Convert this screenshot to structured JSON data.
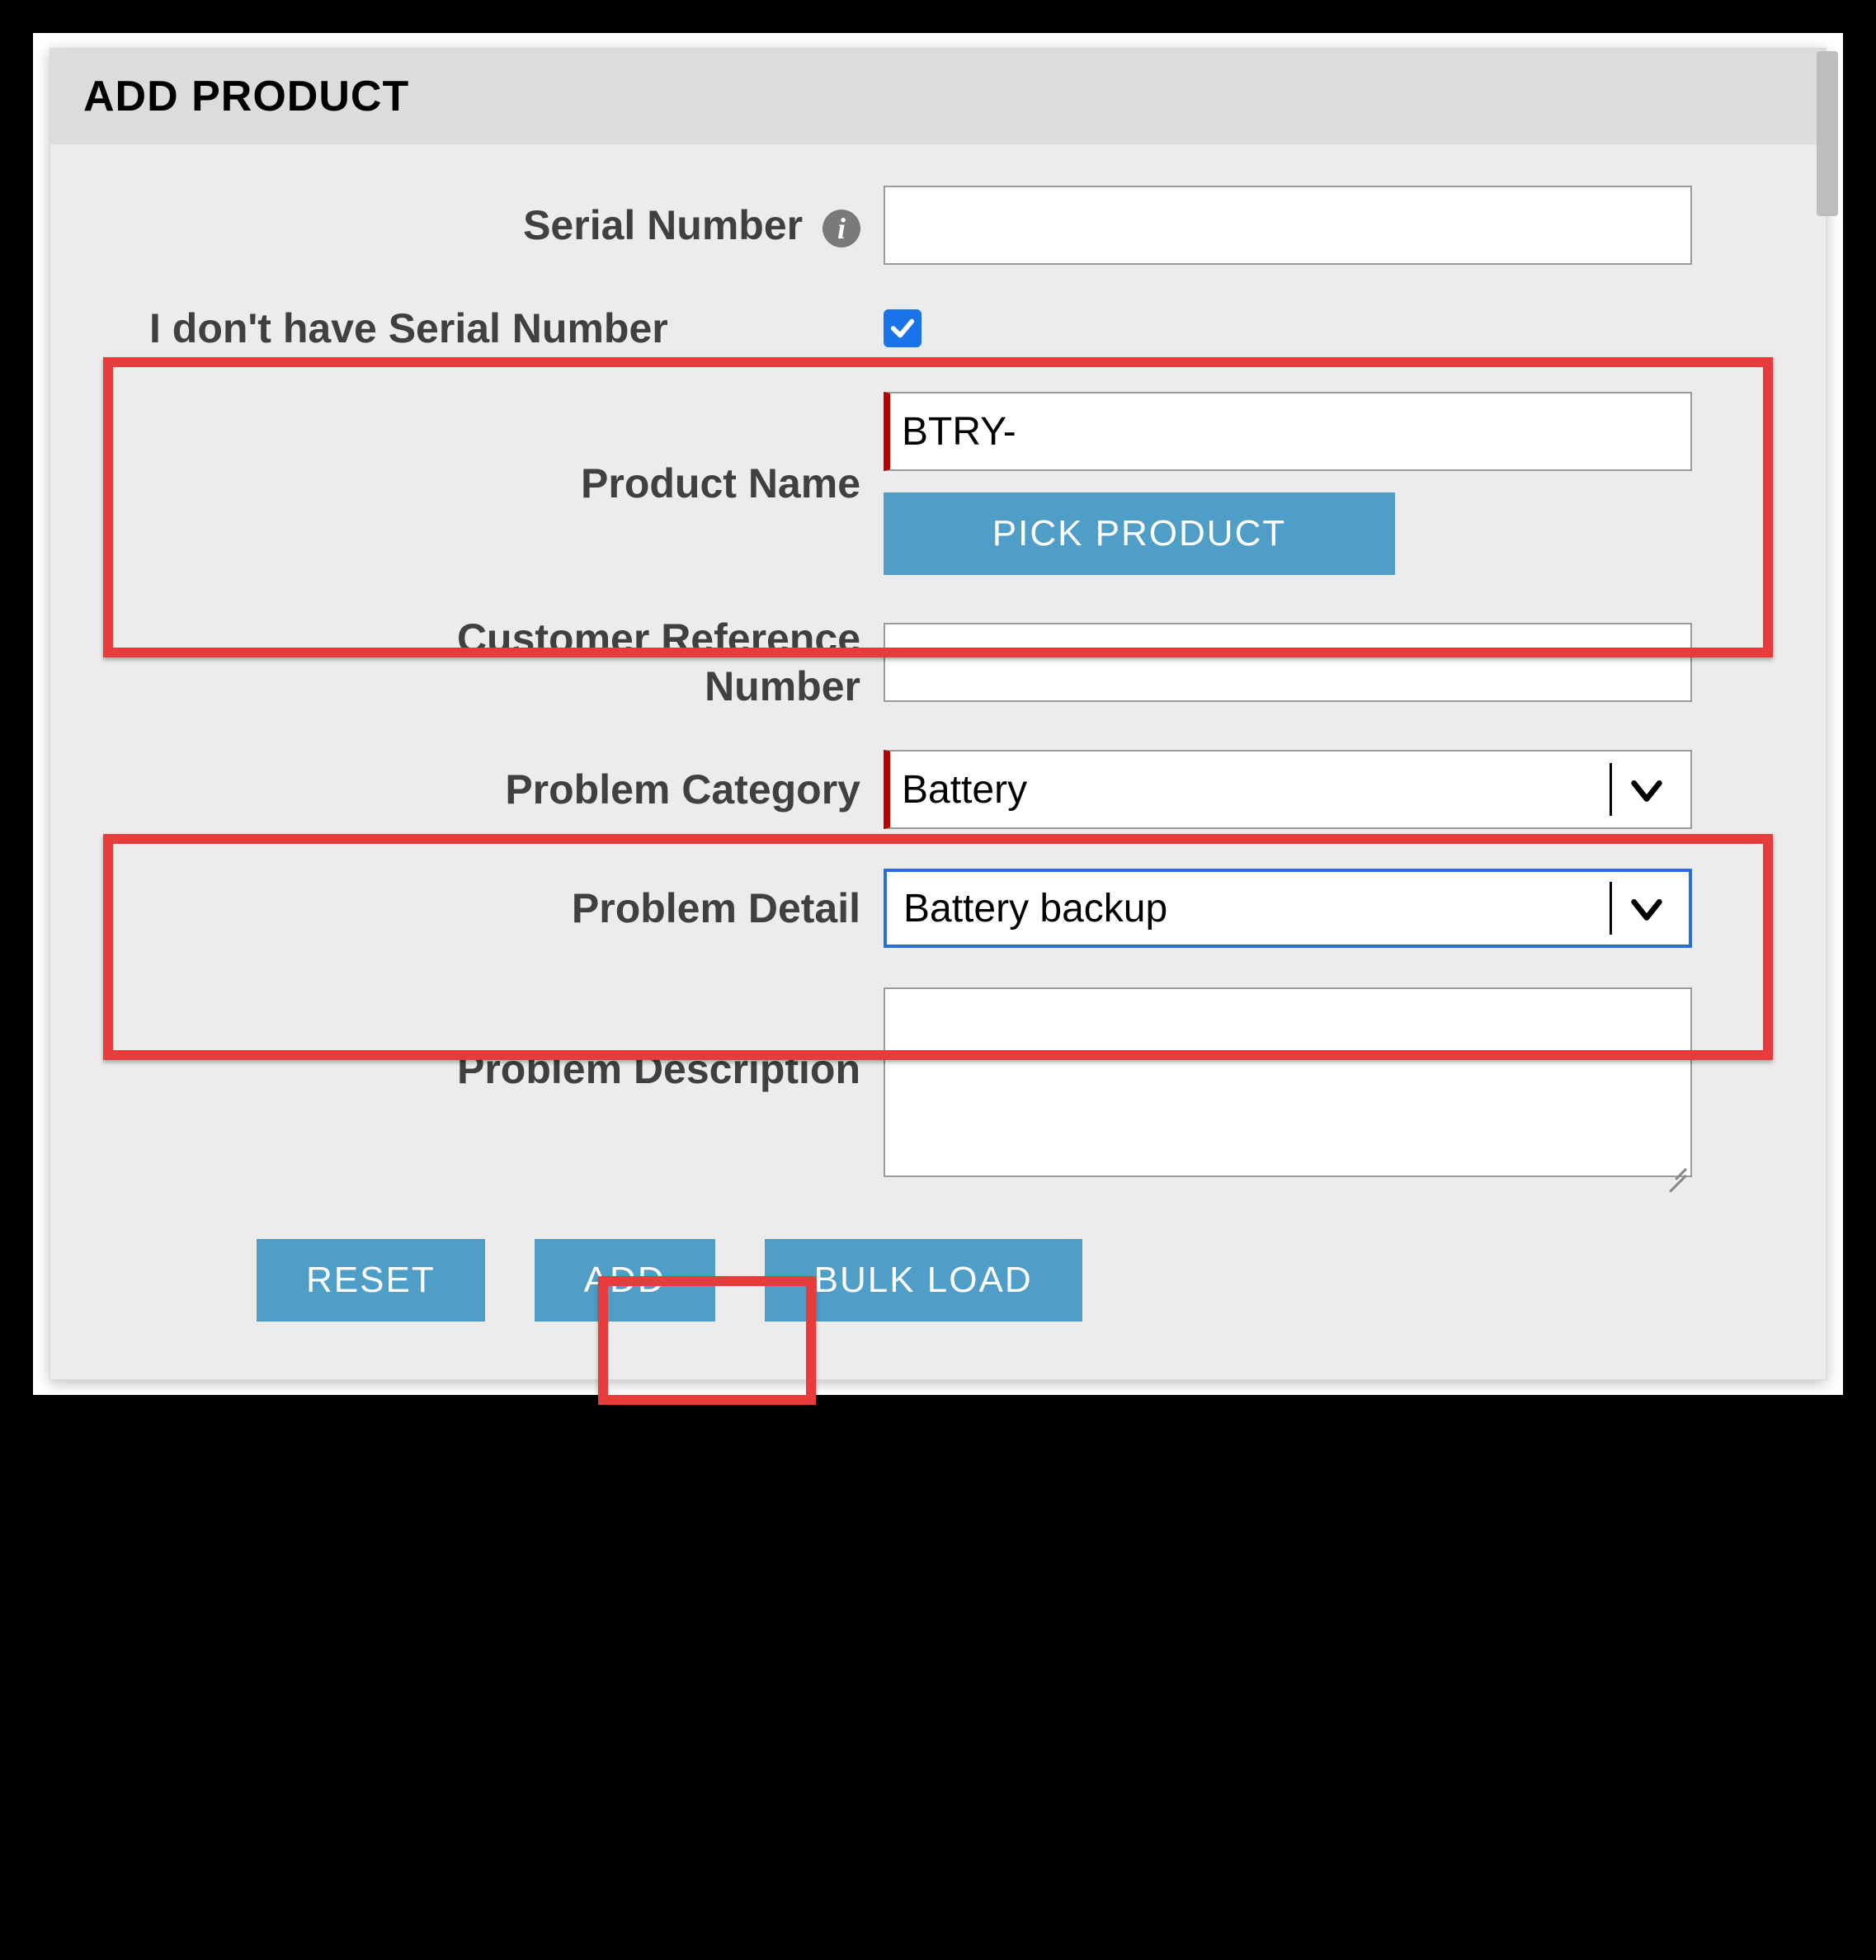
{
  "panel": {
    "title": "ADD PRODUCT"
  },
  "form": {
    "serial_number": {
      "label": "Serial Number",
      "value": ""
    },
    "no_serial": {
      "label": "I don't have Serial Number",
      "checked": true
    },
    "product_name": {
      "label": "Product Name",
      "value": "BTRY-"
    },
    "pick_product_label": "PICK PRODUCT",
    "customer_ref": {
      "label": "Customer Reference Number",
      "value": ""
    },
    "problem_category": {
      "label": "Problem Category",
      "value": "Battery"
    },
    "problem_detail": {
      "label": "Problem Detail",
      "value": "Battery backup"
    },
    "problem_description": {
      "label": "Problem Description",
      "value": ""
    }
  },
  "actions": {
    "reset": "RESET",
    "add": "ADD",
    "bulk_load": "BULK LOAD"
  },
  "icons": {
    "info": "info-icon",
    "checkmark": "checkmark-icon",
    "chevron_down": "chevron-down-icon"
  },
  "colors": {
    "accent": "#4e9ec7",
    "highlight": "#e83b3b",
    "required": "#b70000",
    "checkbox": "#1a73e8"
  }
}
